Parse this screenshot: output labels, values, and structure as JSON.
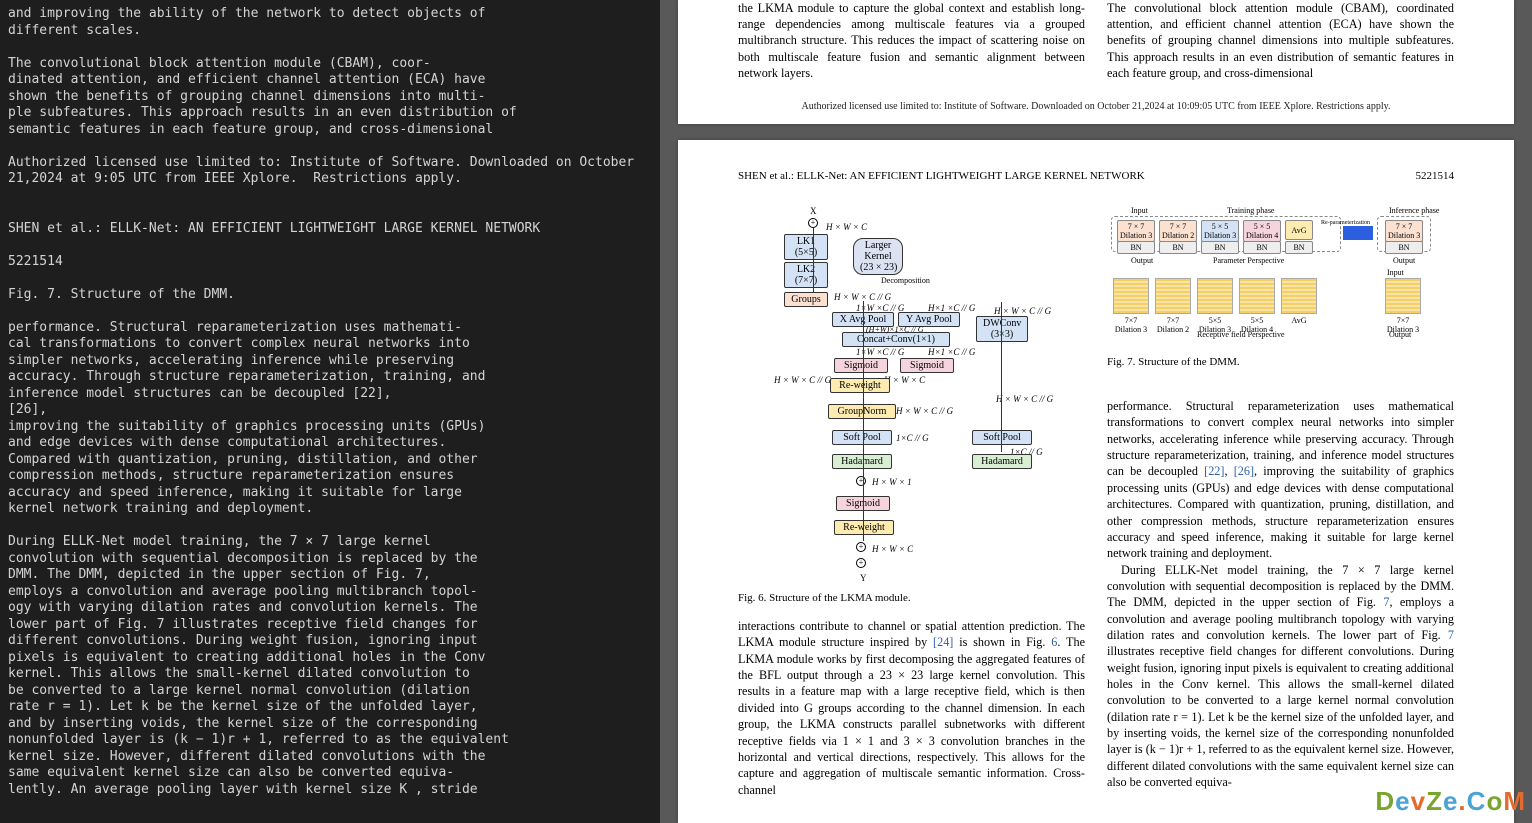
{
  "left_text": "and improving the ability of the network to detect objects of\ndifferent scales.\n\nThe convolutional block attention module (CBAM), coor-\ndinated attention, and efficient channel attention (ECA) have\nshown the benefits of grouping channel dimensions into multi-\nple subfeatures. This approach results in an even distribution of\nsemantic features in each feature group, and cross-dimensional\n\nAuthorized licensed use limited to: Institute of Software. Downloaded on October 21,2024 at 9:05 UTC from IEEE Xplore.  Restrictions apply.\n\n\nSHEN et al.: ELLK-Net: AN EFFICIENT LIGHTWEIGHT LARGE KERNEL NETWORK\n\n5221514\n\nFig. 7. Structure of the DMM.\n\nperformance. Structural reparameterization uses mathemati-\ncal transformations to convert complex neural networks into\nsimpler networks, accelerating inference while preserving\naccuracy. Through structure reparameterization, training, and\ninference model structures can be decoupled [22],\n[26],\nimproving the suitability of graphics processing units (GPUs)\nand edge devices with dense computational architectures.\nCompared with quantization, pruning, distillation, and other\ncompression methods, structure reparameterization ensures\naccuracy and speed inference, making it suitable for large\nkernel network training and deployment.\n\nDuring ELLK-Net model training, the 7 × 7 large kernel\nconvolution with sequential decomposition is replaced by the\nDMM. The DMM, depicted in the upper section of Fig. 7,\nemploys a convolution and average pooling multibranch topol-\nogy with varying dilation rates and convolution kernels. The\nlower part of Fig. 7 illustrates receptive field changes for\ndifferent convolutions. During weight fusion, ignoring input\npixels is equivalent to creating additional holes in the Conv\nkernel. This allows the small-kernel dilated convolution to\nbe converted to a large kernel normal convolution (dilation\nrate r = 1). Let k be the kernel size of the unfolded layer,\nand by inserting voids, the kernel size of the corresponding\nnonunfolded layer is (k − 1)r + 1, referred to as the equivalent\nkernel size. However, different dilated convolutions with the\nsame equivalent kernel size can also be converted equiva-\nlently. An average pooling layer with kernel size K , stride",
  "page1": {
    "colL": "the LKMA module to capture the global context and establish long-range dependencies among multiscale features via a grouped multibranch structure. This reduces the impact of scattering noise on both multiscale feature fusion and semantic alignment between network layers.",
    "colR": "The convolutional block attention module (CBAM), coordinated attention, and efficient channel attention (ECA) have shown the benefits of grouping channel dimensions into multiple subfeatures. This approach results in an even distribution of semantic features in each feature group, and cross-dimensional",
    "license": "Authorized licensed use limited to: Institute of Software. Downloaded on October 21,2024 at 10:09:05 UTC from IEEE Xplore. Restrictions apply."
  },
  "page2": {
    "head_left": "SHEN et al.: ELLK-Net: AN EFFICIENT LIGHTWEIGHT LARGE KERNEL NETWORK",
    "head_right": "5221514",
    "fig6": {
      "caption": "Fig. 6.    Structure of the LKMA module.",
      "labels": {
        "X": "X",
        "Y": "Y",
        "hwc": "H × W × C",
        "lk1": "LK1\n(5×5)",
        "lk2": "LK2\n(7×7)",
        "larger": "Larger\nKernel\n(23 × 23)",
        "decomp": "Decomposition",
        "groups": "Groups",
        "hwcg": "H × W × C // G",
        "xavg": "X Avg Pool",
        "yavg": "Y Avg Pool",
        "dim1": "1×W ×C // G",
        "dim2": "H×1 ×C // G",
        "concat": "Concat+Conv(1×1)",
        "hw11": "(H+W)×1×C // G",
        "sig": "Sigmoid",
        "rew": "Re-weight",
        "gnorm": "GroupNorm",
        "softpool": "Soft Pool",
        "hadamard": "Hadamard",
        "dwconv": "DWConv\n(3×3)",
        "hxwx1": "H × W × 1",
        "onexc": "1×C // G"
      }
    },
    "fig7": {
      "caption": "Fig. 7.    Structure of the DMM.",
      "input": "Input",
      "output": "Output",
      "training": "Training phase",
      "inference": "Inference phase",
      "reparam": "Re-parameterization",
      "paramp": "Parameter Perspective",
      "receptive": "Receptive field Perspective",
      "boxes": [
        "7 × 7\nDilation 3",
        "7 × 7\nDilation 2",
        "5 × 5\nDilation 3",
        "5 × 5\nDilation 4",
        "AvG",
        "7 × 7\nDilation 3"
      ],
      "bn": "BN",
      "sqlabels": [
        "7×7 Dilation 3",
        "7×7 Dilation 2",
        "5×5 Dilation 3",
        "5×5 Dilation 4",
        "AvG",
        "7×7 Dilation 3"
      ]
    },
    "bodyL_p1": "interactions contribute to channel or spatial attention prediction. The LKMA module structure inspired by ",
    "bodyL_ref24": "[24]",
    "bodyL_p1b": " is shown in Fig. ",
    "bodyL_ref6": "6",
    "bodyL_p1c": ". The LKMA module works by first decomposing the aggregated features of the BFL output through a 23 × 23 large kernel convolution. This results in a feature map with a large receptive field, which is then divided into G groups according to the channel dimension. In each group, the LKMA constructs parallel subnetworks with different receptive fields via 1 × 1 and 3 × 3 convolution branches in the horizontal and vertical directions, respectively. This allows for the capture and aggregation of multiscale semantic information. Cross-channel",
    "bodyR_p1": "performance. Structural reparameterization uses mathematical transformations to convert complex neural networks into simpler networks, accelerating inference while preserving accuracy. Through structure reparameterization, training, and inference model structures can be decoupled ",
    "bodyR_ref22": "[22]",
    "bodyR_comma": ", ",
    "bodyR_ref26": "[26]",
    "bodyR_p1b": ", improving the suitability of graphics processing units (GPUs) and edge devices with dense computational architectures. Compared with quantization, pruning, distillation, and other compression methods, structure reparameterization ensures accuracy and speed inference, making it suitable for large kernel network training and deployment.",
    "bodyR_p2a": "During ELLK-Net model training, the 7 × 7 large kernel convolution with sequential decomposition is replaced by the DMM. The DMM, depicted in the upper section of Fig. ",
    "bodyR_ref7": "7",
    "bodyR_p2b": ", employs a convolution and average pooling multibranch topology with varying dilation rates and convolution kernels. The lower part of Fig. ",
    "bodyR_ref7b": "7",
    "bodyR_p2c": " illustrates receptive field changes for different convolutions. During weight fusion, ignoring input pixels is equivalent to creating additional holes in the Conv kernel. This allows the small-kernel dilated convolution to be converted to a large kernel normal convolution (dilation rate r = 1). Let k be the kernel size of the unfolded layer, and by inserting voids, the kernel size of the corresponding nonunfolded layer is (k − 1)r + 1, referred to as the equivalent kernel size. However, different dilated convolutions with the same equivalent kernel size can also be converted equiva-"
  },
  "logo": "DevZe.CoM"
}
